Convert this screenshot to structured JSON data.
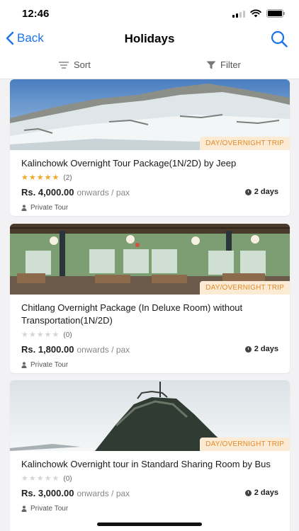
{
  "status": {
    "time": "12:46"
  },
  "nav": {
    "back_label": "Back",
    "title": "Holidays"
  },
  "toolbar": {
    "sort_label": "Sort",
    "filter_label": "Filter"
  },
  "cards": [
    {
      "badge": "DAY/OVERNIGHT TRIP",
      "title": "Kalinchowk Overnight Tour Package(1N/2D) by Jeep",
      "stars": 5,
      "rating_count": "(2)",
      "price": "Rs. 4,000.00",
      "price_suffix": "onwards / pax",
      "duration": "2 days",
      "tour_type": "Private Tour"
    },
    {
      "badge": "DAY/OVERNIGHT TRIP",
      "title": "Chitlang Overnight Package (In Deluxe Room) without Transportation(1N/2D)",
      "stars": 0,
      "rating_count": "(0)",
      "price": "Rs. 1,800.00",
      "price_suffix": "onwards / pax",
      "duration": "2 days",
      "tour_type": "Private Tour"
    },
    {
      "badge": "DAY/OVERNIGHT TRIP",
      "title": "Kalinchowk Overnight tour in Standard Sharing Room by Bus",
      "stars": 0,
      "rating_count": "(0)",
      "price": "Rs. 3,000.00",
      "price_suffix": "onwards / pax",
      "duration": "2 days",
      "tour_type": "Private Tour"
    }
  ],
  "colors": {
    "accent": "#1a73e8",
    "badge_bg": "#fcebd4",
    "badge_text": "#e38a2a",
    "star": "#f5a623"
  }
}
